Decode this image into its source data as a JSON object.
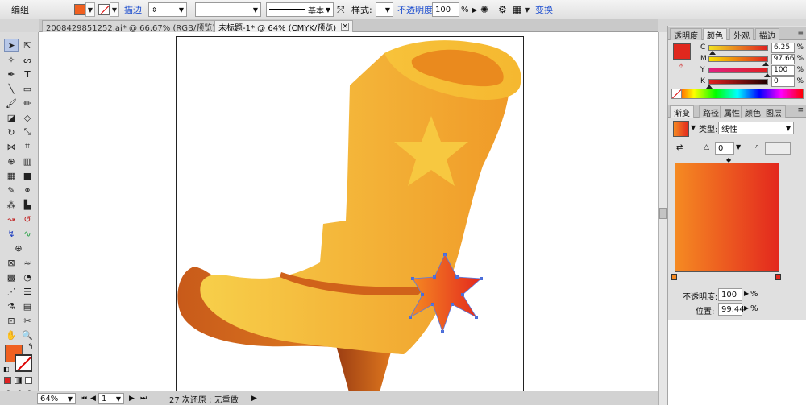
{
  "toolbar": {
    "group_label": "编组",
    "fill_color": "#f06020",
    "stroke_label": "描边",
    "stroke_profile_label": "基本",
    "style_label": "样式:",
    "opacity_label": "不透明度:",
    "opacity_value": "100",
    "opacity_unit": "%",
    "transform_label": "变换"
  },
  "tabs": [
    {
      "label": "2008429851252.ai* @ 66.67% (RGB/预览)",
      "active": false
    },
    {
      "label": "未标题-1* @ 64% (CMYK/预览)",
      "active": true
    }
  ],
  "color_panel": {
    "tabs": [
      "透明度",
      "颜色",
      "外观",
      "描边"
    ],
    "active_tab": "颜色",
    "swatch_color": "#e0281e",
    "channels": [
      {
        "name": "C",
        "value": "6.25",
        "unit": "%",
        "fraction": 0.0625
      },
      {
        "name": "M",
        "value": "97.66",
        "unit": "%",
        "fraction": 0.9766
      },
      {
        "name": "Y",
        "value": "100",
        "unit": "%",
        "fraction": 1.0
      },
      {
        "name": "K",
        "value": "0",
        "unit": "%",
        "fraction": 0.0
      }
    ]
  },
  "gradient_panel": {
    "tabs": [
      "渐变",
      "路径",
      "属性",
      "颜色",
      "图层"
    ],
    "active_tab": "渐变",
    "type_label": "类型:",
    "type_value": "线性",
    "angle_value": "0",
    "start_color": "#f58a22",
    "end_color": "#e3281e",
    "opacity_label": "不透明度:",
    "opacity_value": "100",
    "opacity_unit": "%",
    "location_label": "位置:",
    "location_value": "99.44",
    "location_unit": "%"
  },
  "status": {
    "zoom": "64%",
    "page": "1",
    "history": "27 次还原 ; 无重做"
  }
}
